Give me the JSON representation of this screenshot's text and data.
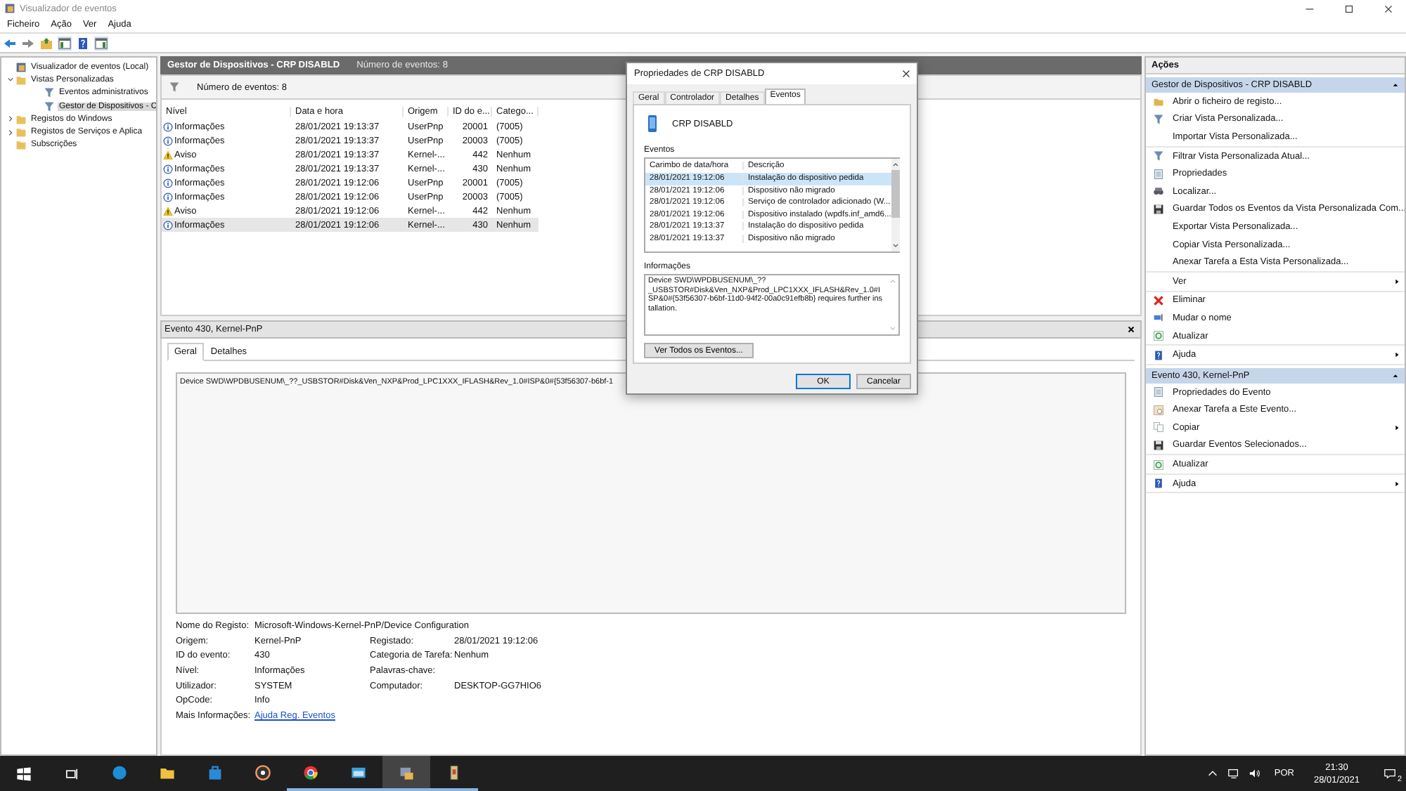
{
  "window": {
    "title": "Visualizador de eventos",
    "menu": [
      "Ficheiro",
      "Ação",
      "Ver",
      "Ajuda"
    ]
  },
  "tree": [
    {
      "label": "Visualizador de eventos (Local)",
      "selected": false,
      "children": [
        {
          "label": "Vistas Personalizadas",
          "selected": false,
          "expanded": true,
          "children": [
            {
              "label": "Eventos administrativos",
              "selected": false
            },
            {
              "label": "Gestor de Dispositivos - C",
              "selected": true
            }
          ]
        },
        {
          "label": "Registos do Windows",
          "selected": false,
          "expanded": false
        },
        {
          "label": "Registos de Serviços e Aplica",
          "selected": false,
          "expanded": false
        },
        {
          "label": "Subscrições",
          "selected": false
        }
      ]
    }
  ],
  "view": {
    "title": "Gestor de Dispositivos - CRP DISABLD",
    "count": "Número de eventos: 8",
    "filter_text": "Número de eventos: 8"
  },
  "table": {
    "columns": [
      "Nível",
      "Data e hora",
      "Origem",
      "ID do e...",
      "Catego..."
    ],
    "rows": [
      {
        "kind": "info",
        "level": "Informações",
        "date": "28/01/2021 19:13:37",
        "source": "UserPnp",
        "id": "20001",
        "category": "(7005)",
        "selected": false
      },
      {
        "kind": "info",
        "level": "Informações",
        "date": "28/01/2021 19:13:37",
        "source": "UserPnp",
        "id": "20003",
        "category": "(7005)",
        "selected": false
      },
      {
        "kind": "warning",
        "level": "Aviso",
        "date": "28/01/2021 19:13:37",
        "source": "Kernel-...",
        "id": "442",
        "category": "Nenhum",
        "selected": false
      },
      {
        "kind": "info",
        "level": "Informações",
        "date": "28/01/2021 19:13:37",
        "source": "Kernel-...",
        "id": "430",
        "category": "Nenhum",
        "selected": false
      },
      {
        "kind": "info",
        "level": "Informações",
        "date": "28/01/2021 19:12:06",
        "source": "UserPnp",
        "id": "20001",
        "category": "(7005)",
        "selected": false
      },
      {
        "kind": "info",
        "level": "Informações",
        "date": "28/01/2021 19:12:06",
        "source": "UserPnp",
        "id": "20003",
        "category": "(7005)",
        "selected": false
      },
      {
        "kind": "warning",
        "level": "Aviso",
        "date": "28/01/2021 19:12:06",
        "source": "Kernel-...",
        "id": "442",
        "category": "Nenhum",
        "selected": false
      },
      {
        "kind": "info",
        "level": "Informações",
        "date": "28/01/2021 19:12:06",
        "source": "Kernel-...",
        "id": "430",
        "category": "Nenhum",
        "selected": true
      }
    ]
  },
  "details": {
    "title": "Evento 430, Kernel-PnP",
    "tabs": [
      {
        "label": "Geral",
        "selected": true
      },
      {
        "label": "Detalhes",
        "selected": false
      }
    ],
    "message": "Device SWD\\WPDBUSENUM\\_??_USBSTOR#Disk&Ven_NXP&Prod_LPC1XXX_IFLASH&Rev_1.0#ISP&0#{53f56307-b6bf-1",
    "fields": [
      {
        "left": {
          "label": "Nome do Registo:",
          "value": "Microsoft-Windows-Kernel-PnP/Device Configuration"
        }
      },
      {
        "left": {
          "label": "Origem:",
          "value": "Kernel-PnP"
        },
        "right": {
          "label": "Registado:",
          "value": "28/01/2021 19:12:06"
        }
      },
      {
        "left": {
          "label": "ID do evento:",
          "value": "430"
        },
        "right": {
          "label": "Categoria de Tarefa:",
          "value": "Nenhum"
        }
      },
      {
        "left": {
          "label": "Nível:",
          "value": "Informações"
        },
        "right": {
          "label": "Palavras-chave:"
        }
      },
      {
        "left": {
          "label": "Utilizador:",
          "value": "SYSTEM"
        },
        "right": {
          "label": "Computador:",
          "value": "DESKTOP-GG7HIO6"
        }
      },
      {
        "left": {
          "label": "OpCode:",
          "value": "Info"
        }
      },
      {
        "left": {
          "label": "Mais Informações:",
          "link": "Ajuda Reg. Eventos"
        }
      }
    ]
  },
  "actions": {
    "title": "Ações",
    "sections": [
      {
        "title": "Gestor de Dispositivos - CRP DISABLD",
        "groups": [
          [
            {
              "label": "Abrir o ficheiro de registo...",
              "kind": "open"
            },
            {
              "label": "Criar Vista Personalizada...",
              "kind": "filter"
            },
            {
              "label": "Importar Vista Personalizada...",
              "kind": "plain"
            }
          ],
          [
            {
              "label": "Filtrar Vista Personalizada Atual...",
              "kind": "filter"
            },
            {
              "label": "Propriedades",
              "kind": "properties"
            },
            {
              "label": "Localizar...",
              "kind": "find"
            },
            {
              "label": "Guardar Todos os Eventos da Vista Personalizada Com...",
              "kind": "save"
            },
            {
              "label": "Exportar Vista Personalizada...",
              "kind": "plain"
            },
            {
              "label": "Copiar Vista Personalizada...",
              "kind": "plain"
            },
            {
              "label": "Anexar Tarefa a Esta Vista Personalizada...",
              "kind": "plain"
            }
          ],
          [
            {
              "label": "Ver",
              "kind": "plain",
              "submenu": true
            }
          ],
          [
            {
              "label": "Eliminar",
              "kind": "delete"
            },
            {
              "label": "Mudar o nome",
              "kind": "rename"
            },
            {
              "label": "Atualizar",
              "kind": "refresh"
            }
          ],
          [
            {
              "label": "Ajuda",
              "kind": "help",
              "submenu": true
            }
          ]
        ]
      },
      {
        "title": "Evento 430, Kernel-PnP",
        "groups": [
          [
            {
              "label": "Propriedades do Evento",
              "kind": "properties"
            },
            {
              "label": "Anexar Tarefa a Este Evento...",
              "kind": "task"
            },
            {
              "label": "Copiar",
              "kind": "copy",
              "submenu": true
            },
            {
              "label": "Guardar Eventos Selecionados...",
              "kind": "save"
            }
          ],
          [
            {
              "label": "Atualizar",
              "kind": "refresh"
            }
          ],
          [
            {
              "label": "Ajuda",
              "kind": "help",
              "submenu": true
            }
          ]
        ]
      }
    ]
  },
  "dialog": {
    "title": "Propriedades de CRP DISABLD",
    "tabs": [
      {
        "label": "Geral",
        "selected": false
      },
      {
        "label": "Controlador",
        "selected": false
      },
      {
        "label": "Detalhes",
        "selected": false
      },
      {
        "label": "Eventos",
        "selected": true
      }
    ],
    "device": "CRP DISABLD",
    "events_label": "Eventos",
    "columns": [
      "Carimbo de data/hora",
      "Descrição"
    ],
    "rows": [
      {
        "time": "28/01/2021 19:12:06",
        "description": "Instalação do dispositivo pedida",
        "selected": true
      },
      {
        "time": "28/01/2021 19:12:06",
        "description": "Dispositivo não migrado",
        "selected": false
      },
      {
        "time": "28/01/2021 19:12:06",
        "description": "Serviço de controlador adicionado (W...",
        "selected": false
      },
      {
        "time": "28/01/2021 19:12:06",
        "description": "Dispositivo instalado (wpdfs.inf_amd6...",
        "selected": false
      },
      {
        "time": "28/01/2021 19:13:37",
        "description": "Instalação do dispositivo pedida",
        "selected": false
      },
      {
        "time": "28/01/2021 19:13:37",
        "description": "Dispositivo não migrado",
        "selected": false
      }
    ],
    "info_label": "Informações",
    "info": "Device SWD\\WPDBUSENUM\\_??\n_USBSTOR#Disk&Ven_NXP&Prod_LPC1XXX_IFLASH&Rev_1.0#ISP&0#{53f56307-b6bf-11d0-94f2-00a0c91efb8b} requires further installation.",
    "view_all": "Ver Todos os Eventos...",
    "ok": "OK",
    "cancel": "Cancelar"
  },
  "taskbar": {
    "apps": [
      {
        "kind": "edge",
        "running": false,
        "active": false
      },
      {
        "kind": "explorer",
        "running": false,
        "active": false
      },
      {
        "kind": "store",
        "running": false,
        "active": false
      },
      {
        "kind": "media",
        "running": false,
        "active": false
      },
      {
        "kind": "chrome",
        "running": true,
        "active": false
      },
      {
        "kind": "app",
        "running": true,
        "active": false
      },
      {
        "kind": "eventviewer",
        "running": true,
        "active": true
      },
      {
        "kind": "device",
        "running": true,
        "active": false
      }
    ],
    "language": "POR",
    "time": "21:30",
    "date": "28/01/2021",
    "notifications": "2"
  }
}
